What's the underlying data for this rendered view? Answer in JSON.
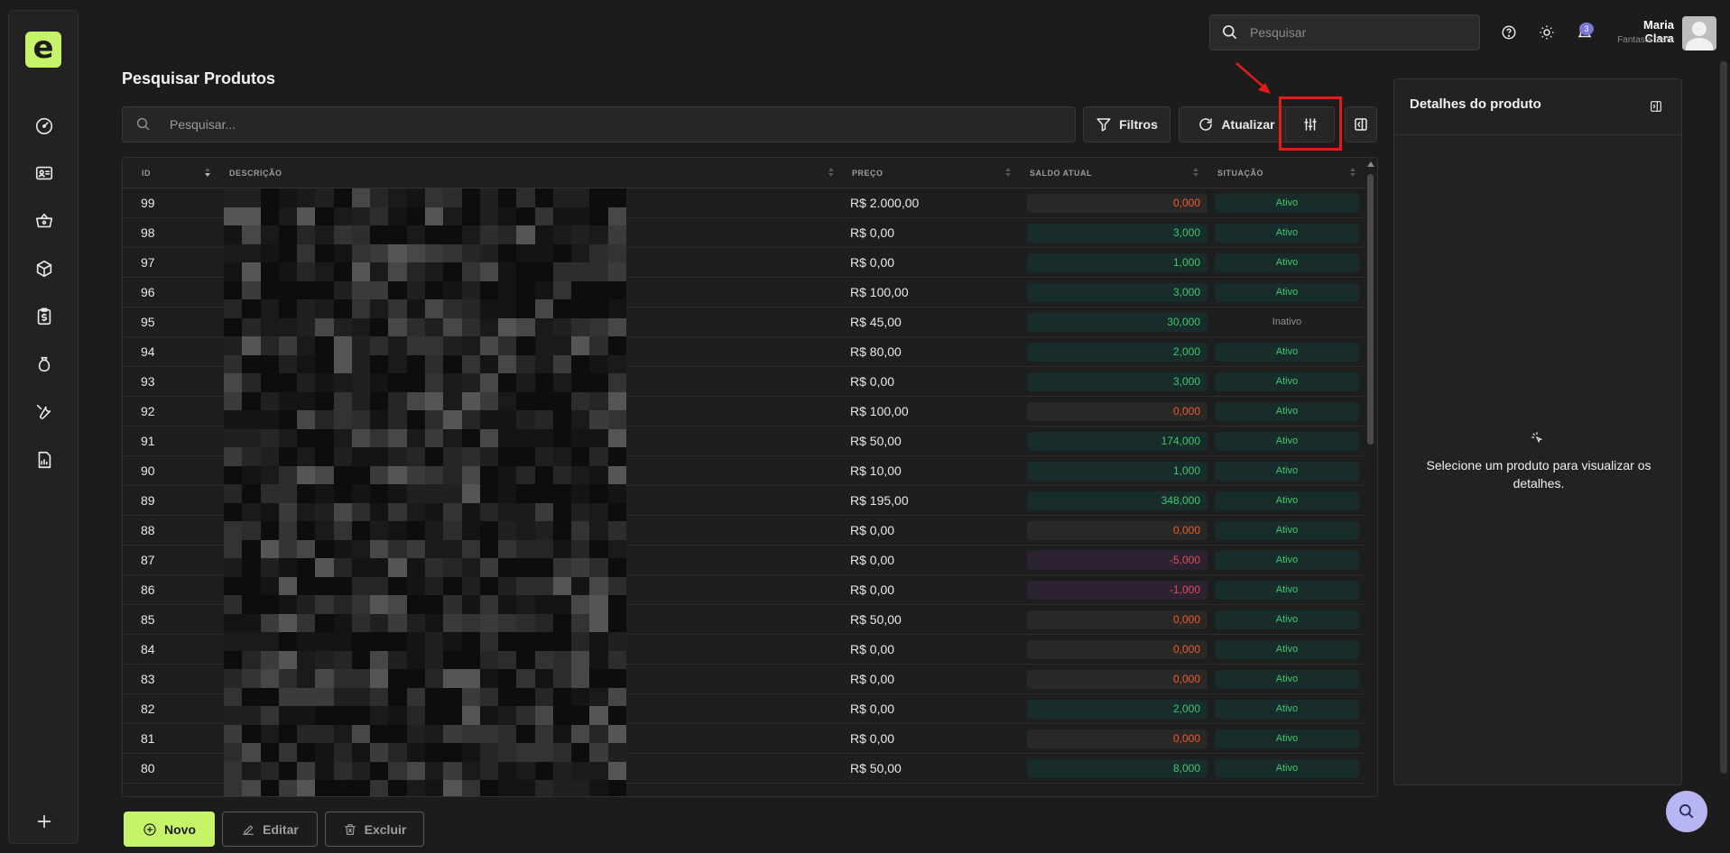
{
  "app": {
    "logo_letter": "e",
    "accent_color": "#c7f36a"
  },
  "sidebar": {
    "icons": [
      "dashboard-icon",
      "id-card-icon",
      "basket-icon",
      "box-icon",
      "clipboard-dollar-icon",
      "money-bag-icon",
      "tools-icon",
      "report-icon"
    ],
    "add_icon": "plus-icon"
  },
  "topbar": {
    "search_placeholder": "Pesquisar",
    "notification_count": "3",
    "user_name": "Maria Clara",
    "user_subtitle": "Fantasia teste"
  },
  "page": {
    "title": "Pesquisar Produtos",
    "search_placeholder": "Pesquisar...",
    "filters_label": "Filtros",
    "refresh_label": "Atualizar"
  },
  "table": {
    "columns": {
      "id": "ID",
      "description": "DESCRIÇÃO",
      "price": "PREÇO",
      "balance": "SALDO ATUAL",
      "status": "SITUAÇÃO"
    },
    "rows": [
      {
        "id": "99",
        "price": "R$ 2.000,00",
        "balance": "0,000",
        "balance_kind": "zero",
        "status": "Ativo"
      },
      {
        "id": "98",
        "price": "R$ 0,00",
        "balance": "3,000",
        "balance_kind": "pos",
        "status": "Ativo"
      },
      {
        "id": "97",
        "price": "R$ 0,00",
        "balance": "1,000",
        "balance_kind": "pos",
        "status": "Ativo"
      },
      {
        "id": "96",
        "price": "R$ 100,00",
        "balance": "3,000",
        "balance_kind": "pos",
        "status": "Ativo"
      },
      {
        "id": "95",
        "price": "R$ 45,00",
        "balance": "30,000",
        "balance_kind": "pos",
        "status": "Inativo"
      },
      {
        "id": "94",
        "price": "R$ 80,00",
        "balance": "2,000",
        "balance_kind": "pos",
        "status": "Ativo"
      },
      {
        "id": "93",
        "price": "R$ 0,00",
        "balance": "3,000",
        "balance_kind": "pos",
        "status": "Ativo"
      },
      {
        "id": "92",
        "price": "R$ 100,00",
        "balance": "0,000",
        "balance_kind": "zero",
        "status": "Ativo"
      },
      {
        "id": "91",
        "price": "R$ 50,00",
        "balance": "174,000",
        "balance_kind": "pos",
        "status": "Ativo"
      },
      {
        "id": "90",
        "price": "R$ 10,00",
        "balance": "1,000",
        "balance_kind": "pos",
        "status": "Ativo"
      },
      {
        "id": "89",
        "price": "R$ 195,00",
        "balance": "348,000",
        "balance_kind": "pos",
        "status": "Ativo"
      },
      {
        "id": "88",
        "price": "R$ 0,00",
        "balance": "0,000",
        "balance_kind": "zero",
        "status": "Ativo"
      },
      {
        "id": "87",
        "price": "R$ 0,00",
        "balance": "-5,000",
        "balance_kind": "neg",
        "status": "Ativo"
      },
      {
        "id": "86",
        "price": "R$ 0,00",
        "balance": "-1,000",
        "balance_kind": "neg",
        "status": "Ativo"
      },
      {
        "id": "85",
        "price": "R$ 50,00",
        "balance": "0,000",
        "balance_kind": "zero",
        "status": "Ativo"
      },
      {
        "id": "84",
        "price": "R$ 0,00",
        "balance": "0,000",
        "balance_kind": "zero",
        "status": "Ativo"
      },
      {
        "id": "83",
        "price": "R$ 0,00",
        "balance": "0,000",
        "balance_kind": "zero",
        "status": "Ativo"
      },
      {
        "id": "82",
        "price": "R$ 0,00",
        "balance": "2,000",
        "balance_kind": "pos",
        "status": "Ativo"
      },
      {
        "id": "81",
        "price": "R$ 0,00",
        "balance": "0,000",
        "balance_kind": "zero",
        "status": "Ativo"
      },
      {
        "id": "80",
        "price": "R$ 50,00",
        "balance": "8,000",
        "balance_kind": "pos",
        "status": "Ativo"
      }
    ]
  },
  "details": {
    "title": "Detalhes do produto",
    "empty_text": "Selecione um produto para visualizar os detalhes."
  },
  "actions": {
    "new_label": "Novo",
    "edit_label": "Editar",
    "delete_label": "Excluir"
  },
  "colors": {
    "positive": "#3fc86a",
    "zero": "#ee5b2c",
    "negative": "#e24b58",
    "highlight": "#e21b1b",
    "fab": "#b7b6f2"
  }
}
